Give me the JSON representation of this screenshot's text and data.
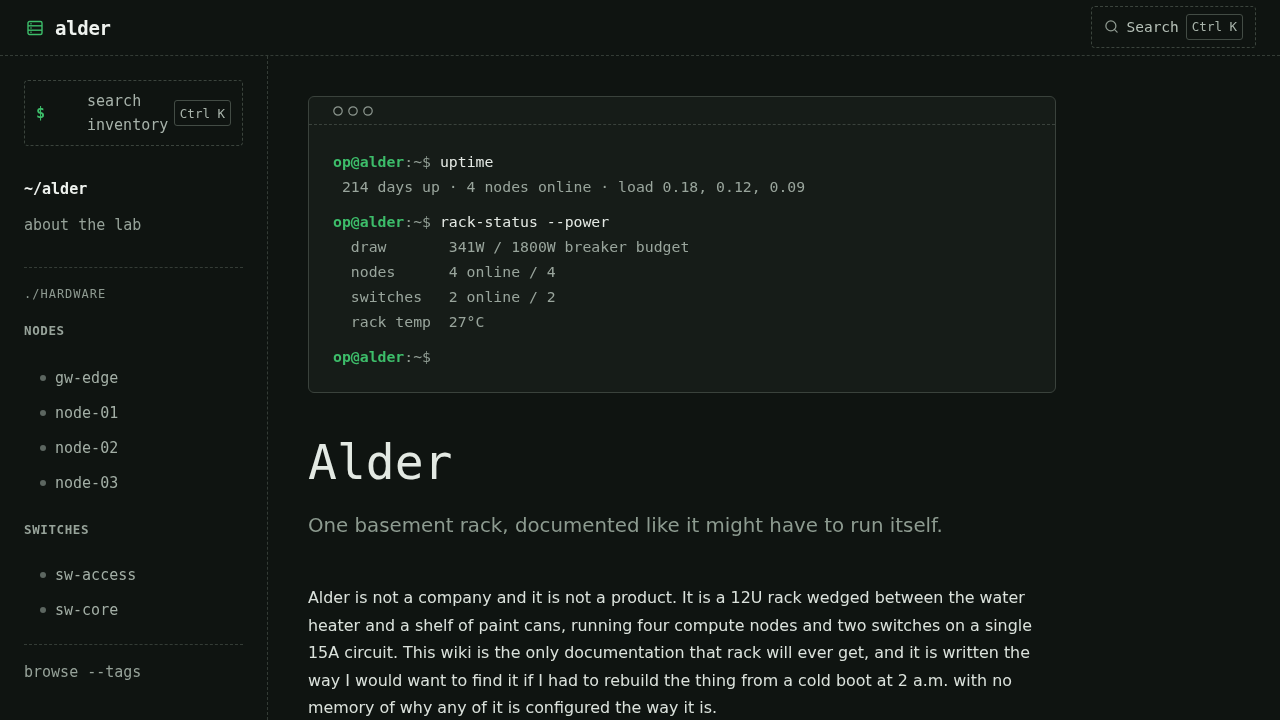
{
  "header": {
    "logo": "alder",
    "search_button": {
      "label": "Search",
      "shortcut": "Ctrl K"
    }
  },
  "sidebar": {
    "search_button": {
      "prompt": "$",
      "label": "search inventory",
      "shortcut": "Ctrl K"
    },
    "links": [
      {
        "label": "~/alder",
        "selected": true
      },
      {
        "label": "about the lab",
        "selected": false
      }
    ],
    "section": {
      "title": "./HARDWARE",
      "groups": [
        {
          "title": "NODES",
          "items": [
            "gw-edge",
            "node-01",
            "node-02",
            "node-03"
          ]
        },
        {
          "title": "SWITCHES",
          "items": [
            "sw-access",
            "sw-core"
          ]
        }
      ]
    },
    "footer_link": "browse --tags"
  },
  "terminal": {
    "blocks": [
      {
        "user": "op@alder",
        "path": ":~$",
        "command": "uptime",
        "output": [
          {
            "kind": "text",
            "text": "214 days up · 4 nodes online · load 0.18, 0.12, 0.09"
          }
        ]
      },
      {
        "user": "op@alder",
        "path": ":~$",
        "command": "rack-status --power",
        "output": [
          {
            "kind": "field",
            "key": "draw",
            "value": "341W / 1800W breaker budget"
          },
          {
            "kind": "field",
            "key": "nodes",
            "value": "4 online / 4"
          },
          {
            "kind": "field",
            "key": "switches",
            "value": "2 online / 2"
          },
          {
            "kind": "field",
            "key": "rack temp",
            "value": "27°C"
          }
        ]
      },
      {
        "user": "op@alder",
        "path": ":~$"
      }
    ]
  },
  "article": {
    "title": "Alder",
    "subtitle": "One basement rack, documented like it might have to run itself.",
    "body": "Alder is not a company and it is not a product. It is a 12U rack wedged between the water heater and a shelf of paint cans, running four compute nodes and two switches on a single 15A circuit. This wiki is the only documentation that rack will ever get, and it is written the way I would want to find it if I had to rebuild the thing from a cold boot at 2 a.m. with no memory of why any of it is configured the way it is."
  }
}
